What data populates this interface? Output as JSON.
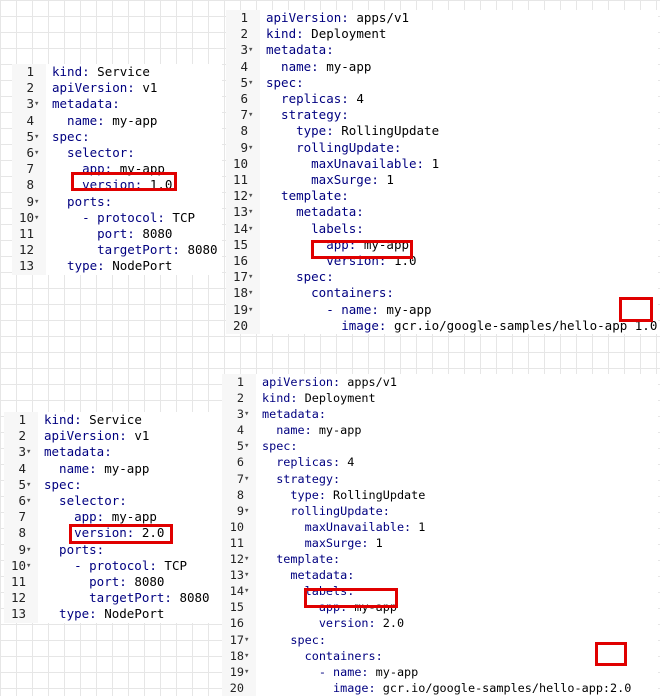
{
  "panels": [
    {
      "id": "top-service",
      "lines": [
        {
          "n": "1",
          "fold": "",
          "code": "kind: Service"
        },
        {
          "n": "2",
          "fold": "",
          "code": "apiVersion: v1"
        },
        {
          "n": "3",
          "fold": "▾",
          "code": "metadata:"
        },
        {
          "n": "4",
          "fold": "",
          "code": "  name: my-app"
        },
        {
          "n": "5",
          "fold": "▾",
          "code": "spec:"
        },
        {
          "n": "6",
          "fold": "▾",
          "code": "  selector:"
        },
        {
          "n": "7",
          "fold": "",
          "code": "    app: my-app"
        },
        {
          "n": "8",
          "fold": "",
          "code": "    version: 1.0"
        },
        {
          "n": "9",
          "fold": "▾",
          "code": "  ports:"
        },
        {
          "n": "10",
          "fold": "▾",
          "code": "    - protocol: TCP"
        },
        {
          "n": "11",
          "fold": "",
          "code": "      port: 8080"
        },
        {
          "n": "12",
          "fold": "",
          "code": "      targetPort: 8080"
        },
        {
          "n": "13",
          "fold": "",
          "code": "  type: NodePort"
        }
      ]
    },
    {
      "id": "top-deployment",
      "lines": [
        {
          "n": "1",
          "fold": "",
          "code": "apiVersion: apps/v1"
        },
        {
          "n": "2",
          "fold": "",
          "code": "kind: Deployment"
        },
        {
          "n": "3",
          "fold": "▾",
          "code": "metadata:"
        },
        {
          "n": "4",
          "fold": "",
          "code": "  name: my-app"
        },
        {
          "n": "5",
          "fold": "▾",
          "code": "spec:"
        },
        {
          "n": "6",
          "fold": "",
          "code": "  replicas: 4"
        },
        {
          "n": "7",
          "fold": "▾",
          "code": "  strategy:"
        },
        {
          "n": "8",
          "fold": "",
          "code": "    type: RollingUpdate"
        },
        {
          "n": "9",
          "fold": "▾",
          "code": "    rollingUpdate:"
        },
        {
          "n": "10",
          "fold": "",
          "code": "      maxUnavailable: 1"
        },
        {
          "n": "11",
          "fold": "",
          "code": "      maxSurge: 1"
        },
        {
          "n": "12",
          "fold": "▾",
          "code": "  template:"
        },
        {
          "n": "13",
          "fold": "▾",
          "code": "    metadata:"
        },
        {
          "n": "14",
          "fold": "▾",
          "code": "      labels:"
        },
        {
          "n": "15",
          "fold": "",
          "code": "        app: my-app"
        },
        {
          "n": "16",
          "fold": "",
          "code": "        version: 1.0"
        },
        {
          "n": "17",
          "fold": "▾",
          "code": "    spec:"
        },
        {
          "n": "18",
          "fold": "▾",
          "code": "      containers:"
        },
        {
          "n": "19",
          "fold": "▾",
          "code": "        - name: my-app"
        },
        {
          "n": "20",
          "fold": "",
          "code": "          image: gcr.io/google-samples/hello-app 1.0"
        }
      ]
    },
    {
      "id": "bottom-service",
      "lines": [
        {
          "n": "1",
          "fold": "",
          "code": "kind: Service"
        },
        {
          "n": "2",
          "fold": "",
          "code": "apiVersion: v1"
        },
        {
          "n": "3",
          "fold": "▾",
          "code": "metadata:"
        },
        {
          "n": "4",
          "fold": "",
          "code": "  name: my-app"
        },
        {
          "n": "5",
          "fold": "▾",
          "code": "spec:"
        },
        {
          "n": "6",
          "fold": "▾",
          "code": "  selector:"
        },
        {
          "n": "7",
          "fold": "",
          "code": "    app: my-app"
        },
        {
          "n": "8",
          "fold": "",
          "code": "    version: 2.0"
        },
        {
          "n": "9",
          "fold": "▾",
          "code": "  ports:"
        },
        {
          "n": "10",
          "fold": "▾",
          "code": "    - protocol: TCP"
        },
        {
          "n": "11",
          "fold": "",
          "code": "      port: 8080"
        },
        {
          "n": "12",
          "fold": "",
          "code": "      targetPort: 8080"
        },
        {
          "n": "13",
          "fold": "",
          "code": "  type: NodePort"
        }
      ]
    },
    {
      "id": "bottom-deployment",
      "lines": [
        {
          "n": "1",
          "fold": "",
          "code": "apiVersion: apps/v1"
        },
        {
          "n": "2",
          "fold": "",
          "code": "kind: Deployment"
        },
        {
          "n": "3",
          "fold": "▾",
          "code": "metadata:"
        },
        {
          "n": "4",
          "fold": "",
          "code": "  name: my-app"
        },
        {
          "n": "5",
          "fold": "▾",
          "code": "spec:"
        },
        {
          "n": "6",
          "fold": "",
          "code": "  replicas: 4"
        },
        {
          "n": "7",
          "fold": "▾",
          "code": "  strategy:"
        },
        {
          "n": "8",
          "fold": "",
          "code": "    type: RollingUpdate"
        },
        {
          "n": "9",
          "fold": "▾",
          "code": "    rollingUpdate:"
        },
        {
          "n": "10",
          "fold": "",
          "code": "      maxUnavailable: 1"
        },
        {
          "n": "11",
          "fold": "",
          "code": "      maxSurge: 1"
        },
        {
          "n": "12",
          "fold": "▾",
          "code": "  template:"
        },
        {
          "n": "13",
          "fold": "▾",
          "code": "    metadata:"
        },
        {
          "n": "14",
          "fold": "▾",
          "code": "      labels:"
        },
        {
          "n": "15",
          "fold": "",
          "code": "        app: my-app"
        },
        {
          "n": "16",
          "fold": "",
          "code": "        version: 2.0"
        },
        {
          "n": "17",
          "fold": "▾",
          "code": "    spec:"
        },
        {
          "n": "18",
          "fold": "▾",
          "code": "      containers:"
        },
        {
          "n": "19",
          "fold": "▾",
          "code": "        - name: my-app"
        },
        {
          "n": "20",
          "fold": "",
          "code": "          image: gcr.io/google-samples/hello-app:2.0"
        }
      ]
    }
  ],
  "highlight_color": "#e00000",
  "key_color": "#000080",
  "value_color": "#000000"
}
